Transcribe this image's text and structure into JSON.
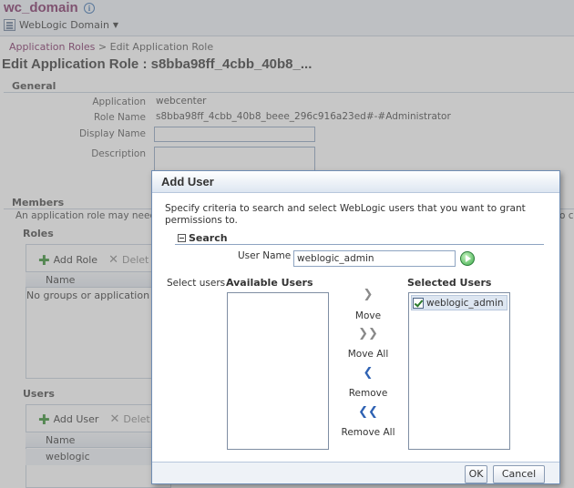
{
  "header": {
    "domain_title": "wc_domain",
    "domain_menu_label": "WebLogic Domain"
  },
  "breadcrumb": {
    "link": "Application Roles",
    "separator": " > ",
    "current": "Edit Application Role"
  },
  "page_title": "Edit Application Role : s8bba98ff_4cbb_40b8_...",
  "general": {
    "heading": "General",
    "application_label": "Application",
    "application_value": "webcenter",
    "role_name_label": "Role Name",
    "role_name_value": "s8bba98ff_4cbb_40b8_beee_296c916a23ed#-#Administrator",
    "display_name_label": "Display Name",
    "description_label": "Description"
  },
  "members": {
    "heading": "Members",
    "text": "An application role may need to",
    "text_tail": "o c"
  },
  "roles_panel": {
    "heading": "Roles",
    "add_label": "Add Role",
    "delete_label": "Delet",
    "col_name": "Name",
    "empty_text": "No groups or application role"
  },
  "users_panel": {
    "heading": "Users",
    "add_label": "Add User",
    "delete_label": "Delet",
    "col_name": "Name",
    "row_1": "weblogic"
  },
  "dialog": {
    "title": "Add User",
    "description": "Specify criteria to search and select WebLogic users that you want to grant permissions to.",
    "search_heading": "Search",
    "user_name_label": "User Name",
    "user_name_value": "weblogic_admin",
    "select_users_label": "Select users",
    "available_heading": "Available Users",
    "selected_heading": "Selected Users",
    "selected_items": [
      "weblogic_admin"
    ],
    "move_label": "Move",
    "move_all_label": "Move All",
    "remove_label": "Remove",
    "remove_all_label": "Remove All",
    "ok_label": "OK",
    "cancel_label": "Cancel"
  },
  "colors": {
    "domain_title": "#7c2a62",
    "accent_blue": "#2f62b3",
    "add_green": "#2f8a2a"
  }
}
